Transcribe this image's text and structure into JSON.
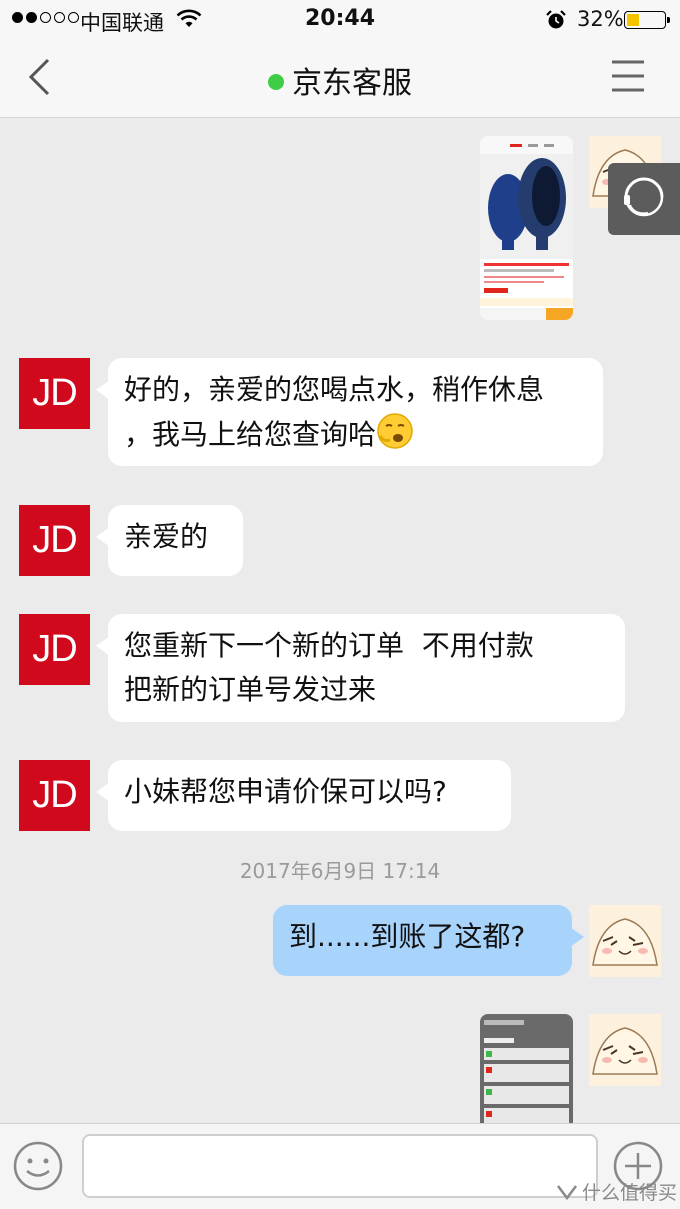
{
  "status_bar": {
    "carrier": "中国联通",
    "time": "20:44",
    "battery": "32%",
    "battery_level": 0.32,
    "signal_strength": 2
  },
  "nav": {
    "title": "京东客服",
    "status_color": "#3fcc46",
    "icons": [
      "chevron-left-icon",
      "menu-icon"
    ]
  },
  "messages": [
    {
      "from": "user",
      "type": "image",
      "icon": "product-screenshot"
    },
    {
      "from": "agent",
      "avatar": "JD",
      "text_lines": [
        "好的，亲爱的您喝点水，稍作休息",
        "，我马上给您查询哈"
      ],
      "emoji": "yawning-emoji"
    },
    {
      "from": "agent",
      "avatar": "JD",
      "text_lines": [
        "亲爱的"
      ]
    },
    {
      "from": "agent",
      "avatar": "JD",
      "text_lines": [
        "您重新下一个新的订单  不用付款",
        "把新的订单号发过来"
      ]
    },
    {
      "from": "agent",
      "avatar": "JD",
      "text_lines": [
        "小妹帮您申请价保可以吗?"
      ]
    },
    {
      "timestamp": "2017年6月9日 17:14"
    },
    {
      "from": "user",
      "text_lines": [
        "到......到账了这都?"
      ]
    },
    {
      "from": "user",
      "type": "image",
      "icon": "notification-screenshot"
    }
  ],
  "input": {
    "placeholder": ""
  },
  "watermark": "什么值得买",
  "colors": {
    "jd_red": "#d0091c",
    "user_bubble": "#a8d3fb",
    "background": "#ebebeb"
  }
}
